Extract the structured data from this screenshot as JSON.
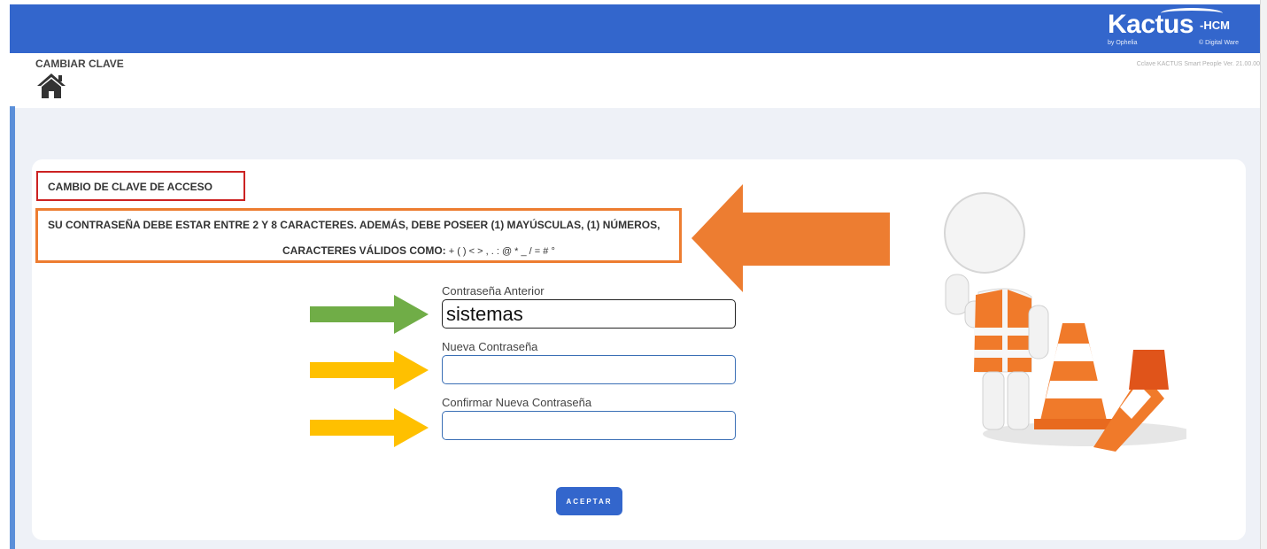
{
  "header": {
    "logo_text": "Kactus",
    "logo_suffix": "-HCM",
    "logo_by": "by Ophelia",
    "logo_copy": "© Digital Ware",
    "version": "Cclave KACTUS Smart People Ver. 21.00.00"
  },
  "page": {
    "title": "CAMBIAR CLAVE",
    "home_icon": "home-icon"
  },
  "form": {
    "section_title": "CAMBIO DE CLAVE DE ACCESO",
    "rules_line1": "SU CONTRASEÑA DEBE ESTAR ENTRE 2 Y 8 CARACTERES. ADEMÁS, DEBE POSEER (1) MAYÚSCULAS, (1) NÚMEROS,",
    "rules_line2_label": "CARACTERES VÁLIDOS COMO:",
    "rules_line2_chars": " + ( ) < > , . : @ * _ / = # °",
    "fields": [
      {
        "label": "Contraseña Anterior",
        "value": "sistemas"
      },
      {
        "label": "Nueva Contraseña",
        "value": ""
      },
      {
        "label": "Confirmar Nueva Contraseña",
        "value": ""
      }
    ],
    "accept_label": "ACEPTAR"
  },
  "colors": {
    "header_blue": "#3366cc",
    "highlight_red": "#cc2222",
    "highlight_orange": "#ed7d31",
    "arrow_green": "#70ad47",
    "arrow_yellow": "#ffc000"
  }
}
